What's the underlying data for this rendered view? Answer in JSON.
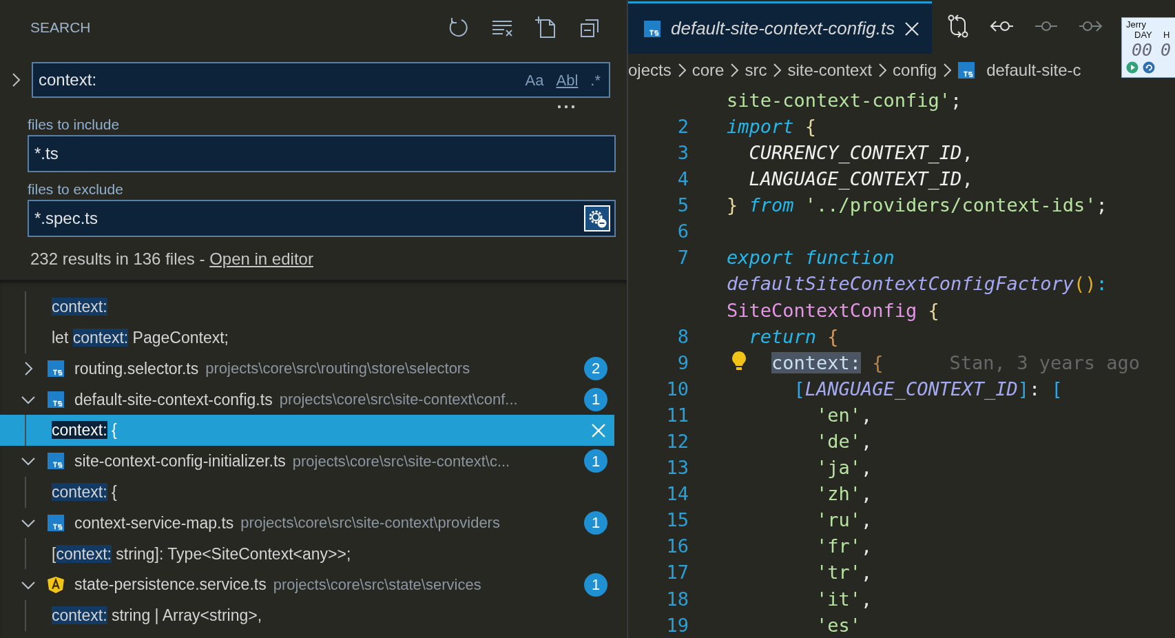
{
  "search_panel": {
    "title": "SEARCH",
    "replace_expanded": false,
    "query": {
      "value": "context:",
      "toggles": [
        {
          "label": "Aa",
          "on": false
        },
        {
          "label": "Abl",
          "on": false
        },
        {
          "label": ".*",
          "on": false
        }
      ]
    },
    "include": {
      "label": "files to include",
      "value": "*.ts"
    },
    "exclude": {
      "label": "files to exclude",
      "value": "*.spec.ts",
      "use_exclude_settings": true
    },
    "summary": "232 results in 136 files - ",
    "open_in_editor": "Open in editor"
  },
  "results": [
    {
      "matches": [
        {
          "match": "context:",
          "selected": false
        },
        {
          "before": "let ",
          "match": "context:",
          "after": " PageContext;",
          "selected": false
        }
      ]
    },
    {
      "file": {
        "name": "routing.selector.ts",
        "path": "projects\\core\\src\\routing\\store\\selectors",
        "count": "2",
        "kind": "typescript",
        "expanded": false
      }
    },
    {
      "file": {
        "name": "default-site-context-config.ts",
        "path": "projects\\core\\src\\site-context\\conf...",
        "count": "1",
        "kind": "typescript",
        "expanded": true
      },
      "matches": [
        {
          "match": "context:",
          "after": " {",
          "selected": true
        }
      ]
    },
    {
      "file": {
        "name": "site-context-config-initializer.ts",
        "path": "projects\\core\\src\\site-context\\c...",
        "count": "1",
        "kind": "typescript",
        "expanded": true
      },
      "matches": [
        {
          "match": "context:",
          "after": " {",
          "selected": false
        }
      ]
    },
    {
      "file": {
        "name": "context-service-map.ts",
        "path": "projects\\core\\src\\site-context\\providers",
        "count": "1",
        "kind": "typescript",
        "expanded": true
      },
      "matches": [
        {
          "before": "[",
          "match": "context:",
          "after": " string]: Type<SiteContext<any>>;",
          "selected": false
        }
      ]
    },
    {
      "file": {
        "name": "state-persistence.service.ts",
        "path": "projects\\core\\src\\state\\services",
        "count": "1",
        "kind": "angular",
        "expanded": true
      },
      "matches": [
        {
          "match": "context:",
          "after": " string | Array<string>,",
          "selected": false
        }
      ]
    }
  ],
  "editor": {
    "tab": {
      "title": "default-site-context-config.ts",
      "preview": true,
      "selected": true
    },
    "actions": [
      {
        "kind": "compare",
        "disabled": false
      },
      {
        "kind": "previous",
        "disabled": false
      },
      {
        "kind": "commit",
        "disabled": true
      },
      {
        "kind": "next",
        "disabled": true
      }
    ],
    "breadcrumb": [
      {
        "label": "ojects",
        "kind": "folder"
      },
      {
        "label": "core",
        "kind": "folder"
      },
      {
        "label": "src",
        "kind": "folder"
      },
      {
        "label": "site-context",
        "kind": "folder"
      },
      {
        "label": "config",
        "kind": "folder"
      },
      {
        "label": "default-site-c",
        "kind": "typescript"
      }
    ],
    "rows": [
      {
        "tokens": [
          {
            "kind": "string",
            "text": "site-context-config'"
          },
          {
            "kind": "plain",
            "text": ";"
          }
        ]
      },
      {
        "number": "2",
        "tokens": [
          {
            "kind": "keyword",
            "text": "import"
          },
          {
            "kind": "brace1",
            "text": " {"
          }
        ]
      },
      {
        "number": "3",
        "tokens": [
          {
            "kind": "const",
            "text": "  CURRENCY_CONTEXT_ID"
          },
          {
            "kind": "plain",
            "text": ","
          }
        ]
      },
      {
        "number": "4",
        "tokens": [
          {
            "kind": "const",
            "text": "  LANGUAGE_CONTEXT_ID"
          },
          {
            "kind": "plain",
            "text": ","
          }
        ]
      },
      {
        "number": "5",
        "tokens": [
          {
            "kind": "brace1",
            "text": "}"
          },
          {
            "kind": "keyword",
            "text": " from"
          },
          {
            "kind": "string",
            "text": " '../providers/context-ids'"
          },
          {
            "kind": "plain",
            "text": ";"
          }
        ]
      },
      {
        "number": "6"
      },
      {
        "number": "7",
        "tokens": [
          {
            "kind": "keyword",
            "text": "export function"
          }
        ]
      },
      {
        "tokens": [
          {
            "kind": "func",
            "text": "defaultSiteContextConfigFactory"
          },
          {
            "kind": "paren",
            "text": "()"
          },
          {
            "kind": "operator",
            "text": ":"
          }
        ]
      },
      {
        "tokens": [
          {
            "kind": "type",
            "text": "SiteContextConfig"
          },
          {
            "kind": "brace1",
            "text": " {"
          }
        ]
      },
      {
        "number": "8",
        "tokens": [
          {
            "kind": "keyword",
            "text": "  return"
          },
          {
            "kind": "brace2",
            "text": " {"
          }
        ]
      },
      {
        "number": "9",
        "lightbulb": true,
        "tokens": [
          {
            "kind": "match",
            "text": "context:"
          },
          {
            "kind": "brace3",
            "text": " {"
          }
        ],
        "indent": "    ",
        "blame": "Stan, 3 years ago"
      },
      {
        "number": "10",
        "tokens": [
          {
            "kind": "bracket",
            "text": "      ["
          },
          {
            "kind": "prop",
            "text": "LANGUAGE_CONTEXT_ID"
          },
          {
            "kind": "bracket",
            "text": "]"
          },
          {
            "kind": "plain",
            "text": ":"
          },
          {
            "kind": "bracket",
            "text": " ["
          }
        ]
      },
      {
        "number": "11",
        "tokens": [
          {
            "kind": "string",
            "text": "        'en'"
          },
          {
            "kind": "plain",
            "text": ","
          }
        ]
      },
      {
        "number": "12",
        "tokens": [
          {
            "kind": "string",
            "text": "        'de'"
          },
          {
            "kind": "plain",
            "text": ","
          }
        ]
      },
      {
        "number": "13",
        "tokens": [
          {
            "kind": "string",
            "text": "        'ja'"
          },
          {
            "kind": "plain",
            "text": ","
          }
        ]
      },
      {
        "number": "14",
        "tokens": [
          {
            "kind": "string",
            "text": "        'zh'"
          },
          {
            "kind": "plain",
            "text": ","
          }
        ]
      },
      {
        "number": "15",
        "tokens": [
          {
            "kind": "string",
            "text": "        'ru'"
          },
          {
            "kind": "plain",
            "text": ","
          }
        ]
      },
      {
        "number": "16",
        "tokens": [
          {
            "kind": "string",
            "text": "        'fr'"
          },
          {
            "kind": "plain",
            "text": ","
          }
        ]
      },
      {
        "number": "17",
        "tokens": [
          {
            "kind": "string",
            "text": "        'tr'"
          },
          {
            "kind": "plain",
            "text": ","
          }
        ]
      },
      {
        "number": "18",
        "tokens": [
          {
            "kind": "string",
            "text": "        'it'"
          },
          {
            "kind": "plain",
            "text": ","
          }
        ]
      },
      {
        "number": "19",
        "tokens": [
          {
            "kind": "string",
            "text": "        'es'"
          }
        ]
      }
    ]
  },
  "timer": {
    "user": "Jerry",
    "units": [
      {
        "label": "DAY",
        "value": "00"
      },
      {
        "label": "H",
        "value": "0"
      }
    ]
  }
}
